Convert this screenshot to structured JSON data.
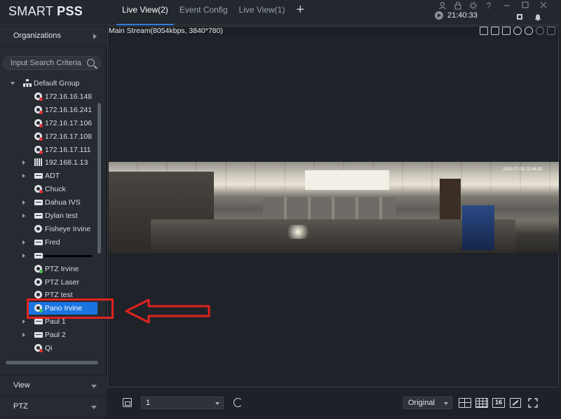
{
  "app": {
    "logo_thin": "SMART",
    "logo_bold": "PSS",
    "clock": "21:40:33"
  },
  "tabs": [
    {
      "label": "Live View(2)",
      "active": true
    },
    {
      "label": "Event Config",
      "active": false
    },
    {
      "label": "Live View(1)",
      "active": false
    }
  ],
  "tab_add": "+",
  "top_icons": [
    "user-icon",
    "lock-icon",
    "settings-icon",
    "help-icon",
    "minimize-icon",
    "restore-icon",
    "close-icon",
    "fullscreen-icon",
    "alarm-bell-icon"
  ],
  "sidebar": {
    "organizations": "Organizations",
    "search_placeholder": "Input Search Criteria",
    "view": "View",
    "ptz": "PTZ",
    "tree": [
      {
        "label": "Default Group",
        "indent": 0,
        "icon": "group",
        "expander": "open"
      },
      {
        "label": "172.16.16.148",
        "indent": 2,
        "icon": "cam-offline",
        "expander": ""
      },
      {
        "label": "172.16.16.241",
        "indent": 2,
        "icon": "cam-offline",
        "expander": ""
      },
      {
        "label": "172.16.17.106",
        "indent": 2,
        "icon": "cam-offline",
        "expander": ""
      },
      {
        "label": "172.16.17.108",
        "indent": 2,
        "icon": "cam-offline",
        "expander": ""
      },
      {
        "label": "172.16.17.111",
        "indent": 2,
        "icon": "cam-offline",
        "expander": ""
      },
      {
        "label": "192.168.1.13",
        "indent": 1,
        "icon": "matrix",
        "expander": "closed"
      },
      {
        "label": "ADT",
        "indent": 1,
        "icon": "nvr",
        "expander": "closed"
      },
      {
        "label": "Chuck",
        "indent": 2,
        "icon": "cam-offline",
        "expander": ""
      },
      {
        "label": "Dahua IVS",
        "indent": 1,
        "icon": "nvr",
        "expander": "closed"
      },
      {
        "label": "Dylan test",
        "indent": 1,
        "icon": "nvr",
        "expander": "closed"
      },
      {
        "label": "Fisheye Irvine",
        "indent": 2,
        "icon": "cam",
        "expander": ""
      },
      {
        "label": "Fred",
        "indent": 1,
        "icon": "nvr",
        "expander": "closed"
      },
      {
        "label": "",
        "indent": 1,
        "icon": "nvr",
        "expander": "closed",
        "redacted": true
      },
      {
        "label": "PTZ Irvine",
        "indent": 2,
        "icon": "cam-online",
        "expander": ""
      },
      {
        "label": "PTZ Laser",
        "indent": 2,
        "icon": "cam",
        "expander": ""
      },
      {
        "label": "PTZ test",
        "indent": 2,
        "icon": "cam",
        "expander": ""
      },
      {
        "label": "Pano Irvine",
        "indent": 2,
        "icon": "cam-online",
        "expander": "",
        "selected": true
      },
      {
        "label": "Paul 1",
        "indent": 1,
        "icon": "nvr",
        "expander": "closed"
      },
      {
        "label": "Paul 2",
        "indent": 1,
        "icon": "nvr",
        "expander": "closed"
      },
      {
        "label": "Qi",
        "indent": 2,
        "icon": "cam-offline",
        "expander": ""
      },
      {
        "label": "",
        "indent": 2,
        "icon": "cam-offline",
        "expander": ""
      }
    ]
  },
  "video": {
    "stream_label": "Main Stream(8054kbps, 3840*780)",
    "overlay_timestamp": "2019-07-09 21:44:33"
  },
  "video_icons": [
    "record-icon",
    "snapshot-icon",
    "audio-icon",
    "microphone-icon",
    "play-icon",
    "zoom-icon",
    "close-icon"
  ],
  "bottom": {
    "window_value": "1",
    "stream_mode": "Original",
    "layout_16_label": "16"
  },
  "colors": {
    "accent": "#1a74e0",
    "annotation": "#e0221f"
  }
}
